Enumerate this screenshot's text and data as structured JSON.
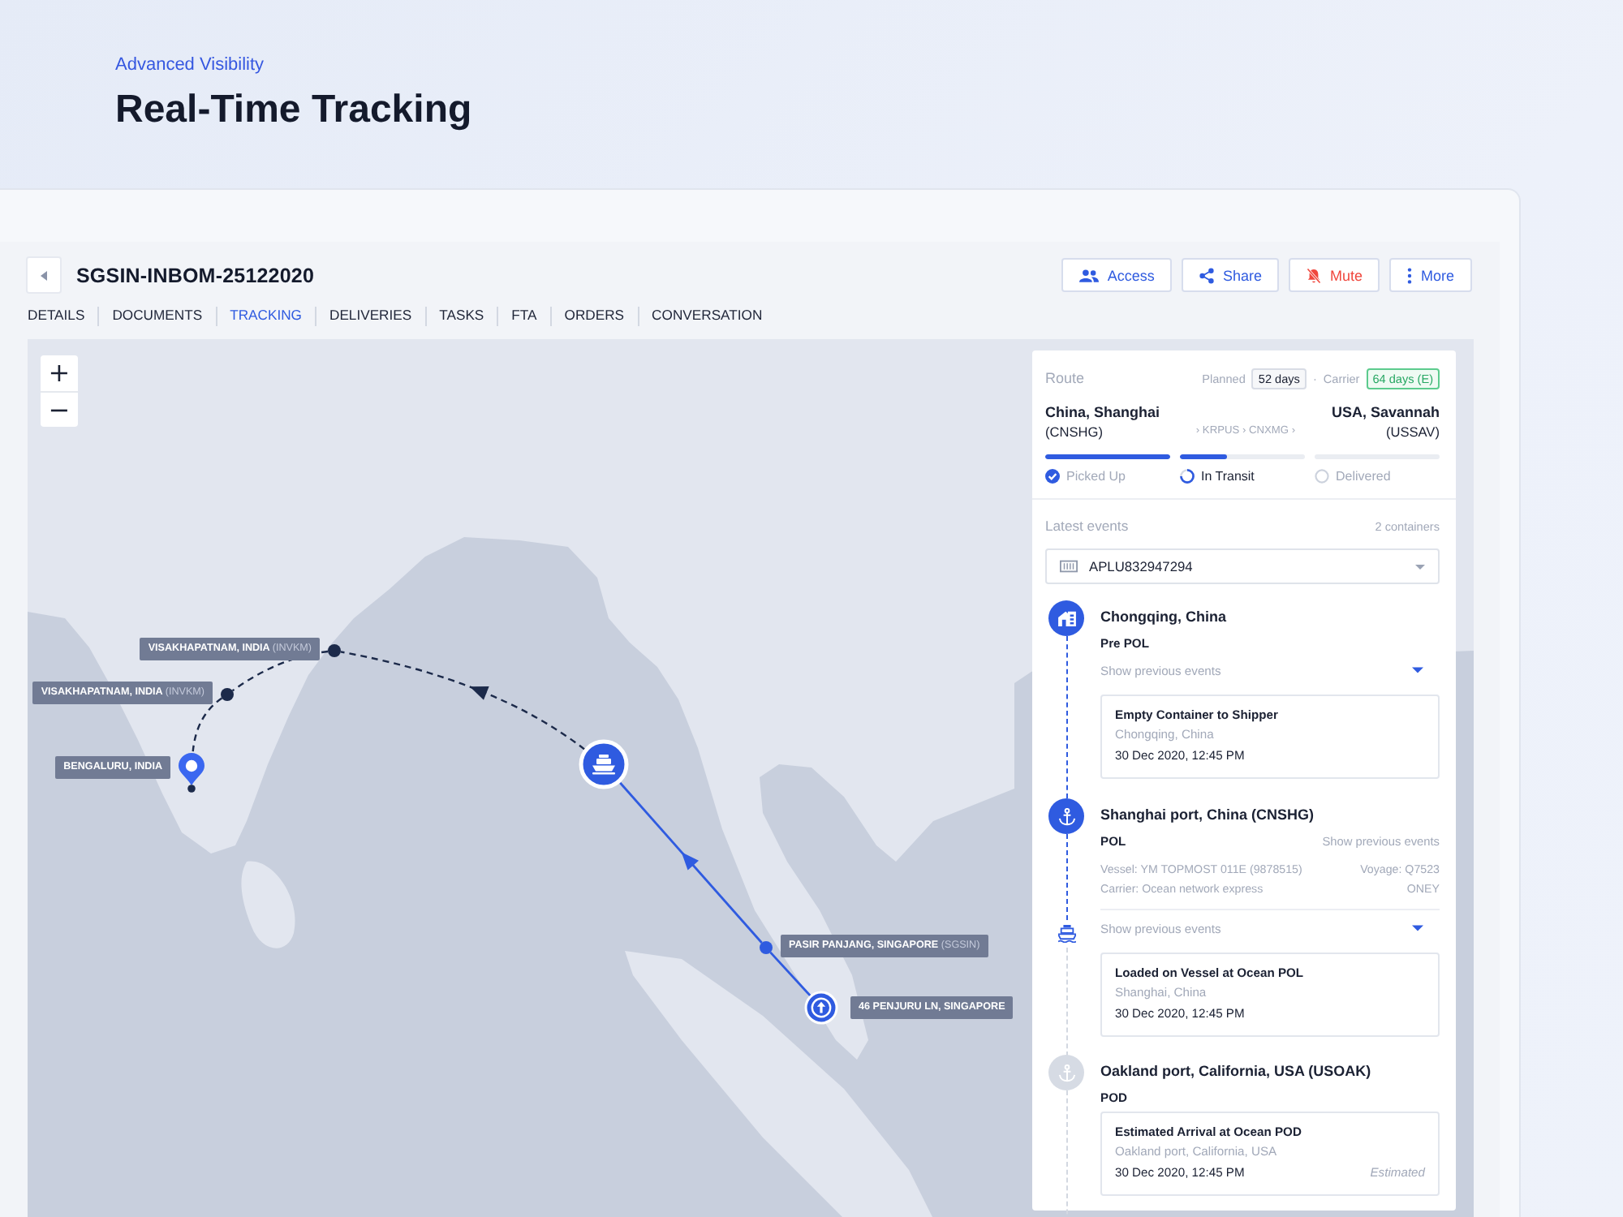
{
  "hero": {
    "eyebrow": "Advanced Visibility",
    "title": "Real-Time Tracking"
  },
  "shipment": {
    "reference": "SGSIN-INBOM-25122020",
    "actions": [
      {
        "kind": "access",
        "label": "Access"
      },
      {
        "kind": "share",
        "label": "Share"
      },
      {
        "kind": "mute",
        "label": "Mute"
      },
      {
        "kind": "more",
        "label": "More"
      }
    ]
  },
  "tabs": [
    {
      "label": "DETAILS",
      "selected": false
    },
    {
      "label": "DOCUMENTS",
      "selected": false
    },
    {
      "label": "TRACKING",
      "selected": true
    },
    {
      "label": "DELIVERIES",
      "selected": false
    },
    {
      "label": "TASKS",
      "selected": false
    },
    {
      "label": "FTA",
      "selected": false
    },
    {
      "label": "ORDERS",
      "selected": false
    },
    {
      "label": "CONVERSATION",
      "selected": false
    }
  ],
  "map": {
    "zoom_controls": [
      "+",
      "−"
    ],
    "stops": [
      {
        "kind": "origin",
        "reached": true,
        "label": "46 PENJURU LN, SINGAPORE"
      },
      {
        "kind": "port",
        "reached": true,
        "label": "PASIR PANJANG, SINGAPORE",
        "code": "(SGSIN)"
      },
      {
        "kind": "vessel",
        "reached": true
      },
      {
        "kind": "port",
        "reached": false,
        "label": "VISAKHAPATNAM, INDIA",
        "code": "(INVKM)"
      },
      {
        "kind": "port",
        "reached": false,
        "label": "VISAKHAPATNAM, INDIA",
        "code": "(INVKM)"
      },
      {
        "kind": "destination",
        "reached": false,
        "label": "BENGALURU, INDIA"
      }
    ]
  },
  "route": {
    "title": "Route",
    "planned_label": "Planned",
    "planned": "52 days",
    "separator": "·",
    "carrier_label": "Carrier",
    "carrier": "64 days (E)",
    "origin": {
      "name": "China, Shanghai",
      "code": "(CNSHG)"
    },
    "via": "› KRPUS › CNXMG ›",
    "destination": {
      "name": "USA, Savannah",
      "code": "(USSAV)"
    },
    "stages": [
      {
        "label": "Picked Up",
        "complete": true,
        "active": false,
        "level": 1
      },
      {
        "label": "In Transit",
        "complete": false,
        "active": true,
        "level": 0.38
      },
      {
        "label": "Delivered",
        "complete": false,
        "active": false,
        "level": 0
      }
    ]
  },
  "events": {
    "title": "Latest events",
    "count": "2 containers",
    "container": "APLU832947294",
    "items": [
      {
        "kind": "warehouse",
        "reached": true,
        "vessel_here": false,
        "place": "Chongqing, China",
        "role": "Pre POL",
        "expander": "Show previous events",
        "entries": [
          {
            "title": "Empty Container to Shipper",
            "location": "Chongqing, China",
            "time": "30 Dec 2020, 12:45 PM"
          }
        ]
      },
      {
        "kind": "anchor",
        "reached": true,
        "vessel_here": true,
        "place": "Shanghai port, China (CNSHG)",
        "role": "POL",
        "role_link": "Show previous events",
        "vessel": "Vessel: YM TOPMOST 011E (9878515)",
        "voyage": "Voyage: Q7523",
        "carrier": "Carrier: Ocean network express",
        "carrier_code": "ONEY",
        "expander": "Show previous events",
        "entries": [
          {
            "title": "Loaded on Vessel at Ocean POL",
            "location": "Shanghai, China",
            "time": "30 Dec 2020, 12:45 PM"
          }
        ]
      },
      {
        "kind": "anchor",
        "reached": false,
        "vessel_here": false,
        "place": "Oakland port, California, USA (USOAK)",
        "role": "POD",
        "entries": [
          {
            "title": "Estimated Arrival at Ocean POD",
            "location": "Oakland port, California, USA",
            "time": "30 Dec 2020, 12:45 PM",
            "note": "Estimated"
          }
        ]
      }
    ]
  }
}
